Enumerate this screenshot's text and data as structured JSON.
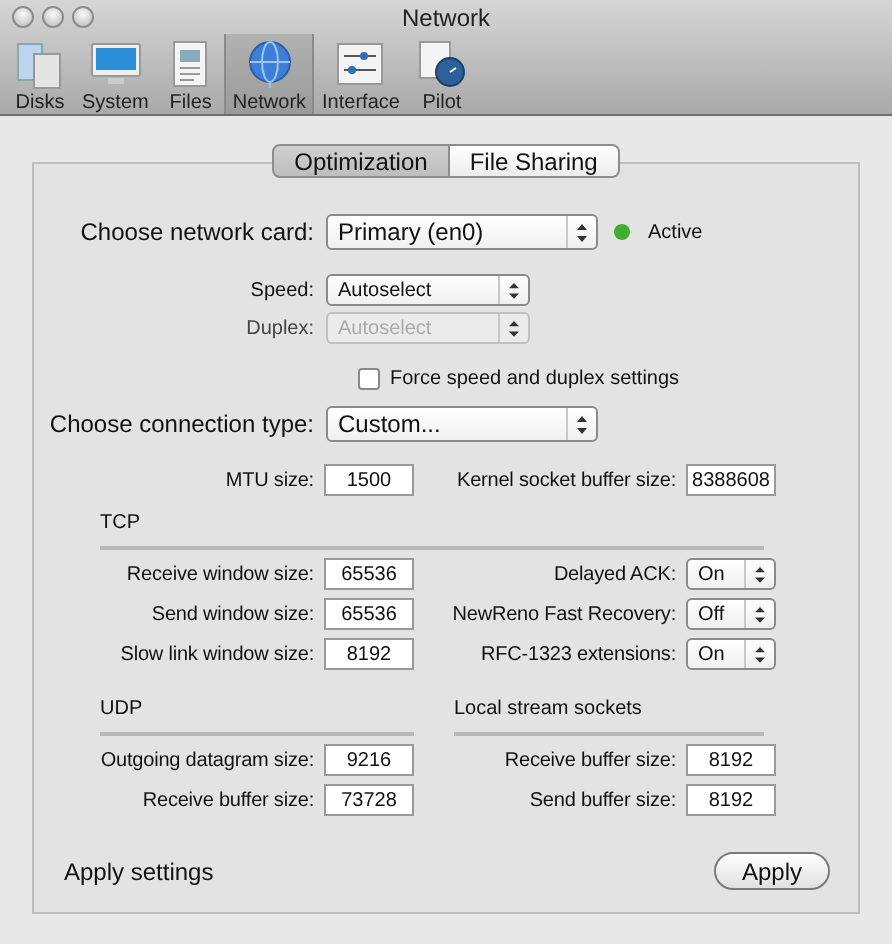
{
  "window": {
    "title": "Network"
  },
  "toolbar": [
    {
      "label": "Disks",
      "kind": "disks",
      "selected": false
    },
    {
      "label": "System",
      "kind": "system",
      "selected": false
    },
    {
      "label": "Files",
      "kind": "files",
      "selected": false
    },
    {
      "label": "Network",
      "kind": "network",
      "selected": true
    },
    {
      "label": "Interface",
      "kind": "interface",
      "selected": false
    },
    {
      "label": "Pilot",
      "kind": "pilot",
      "selected": false
    }
  ],
  "tabs": [
    {
      "label": "Optimization",
      "selected": true
    },
    {
      "label": "File Sharing",
      "selected": false
    }
  ],
  "network_card": {
    "label": "Choose network card:",
    "value": "Primary (en0)",
    "status": "Active",
    "active": true
  },
  "speed": {
    "label": "Speed:",
    "value": "Autoselect",
    "disabled": false
  },
  "duplex": {
    "label": "Duplex:",
    "value": "Autoselect",
    "disabled": true
  },
  "force_checkbox": {
    "label": "Force speed and duplex settings",
    "checked": false
  },
  "connection_type": {
    "label": "Choose connection type:",
    "value": "Custom..."
  },
  "general": [
    {
      "label": "MTU size:",
      "value": "1500"
    },
    {
      "label": "Kernel socket buffer size:",
      "value": "8388608"
    }
  ],
  "tcp": {
    "title": "TCP",
    "fields": [
      {
        "label": "Receive window size:",
        "value": "65536"
      },
      {
        "label": "Send window size:",
        "value": "65536"
      },
      {
        "label": "Slow link window size:",
        "value": "8192"
      }
    ],
    "options": [
      {
        "label": "Delayed ACK:",
        "value": "On"
      },
      {
        "label": "NewReno Fast Recovery:",
        "value": "Off"
      },
      {
        "label": "RFC-1323 extensions:",
        "value": "On"
      }
    ]
  },
  "udp": {
    "title": "UDP",
    "fields": [
      {
        "label": "Outgoing datagram size:",
        "value": "9216"
      },
      {
        "label": "Receive buffer size:",
        "value": "73728"
      }
    ]
  },
  "local_stream_sockets": {
    "title": "Local stream sockets",
    "fields": [
      {
        "label": "Receive buffer size:",
        "value": "8192"
      },
      {
        "label": "Send buffer size:",
        "value": "8192"
      }
    ]
  },
  "footer": {
    "label": "Apply settings",
    "button": "Apply"
  }
}
